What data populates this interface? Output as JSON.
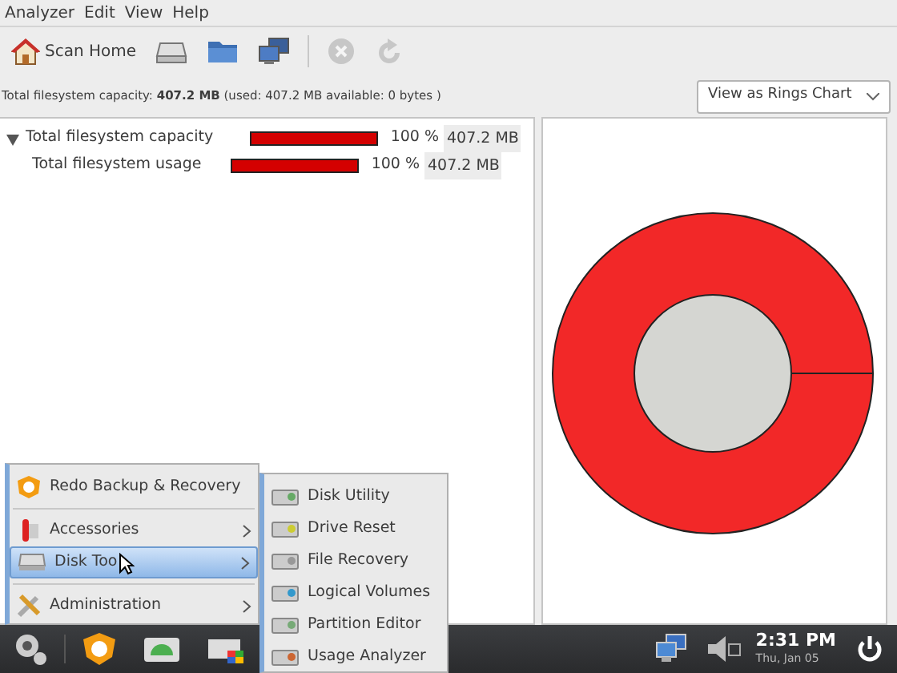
{
  "menu_bar": [
    "Analyzer",
    "Edit",
    "View",
    "Help"
  ],
  "toolbar": [
    {
      "kind": "button",
      "label": "Scan Home",
      "disabled": false
    },
    {
      "kind": "icon",
      "disabled": false
    },
    {
      "kind": "icon",
      "disabled": false
    },
    {
      "kind": "icon",
      "disabled": false
    },
    {
      "kind": "icon",
      "disabled": true
    },
    {
      "kind": "icon",
      "disabled": true
    }
  ],
  "summary": "Total filesystem capacity: **407.2 MB** (used: 407.2 MB available: 0 bytes )",
  "view_select": {
    "value": "View as Rings Chart"
  },
  "tree": [
    {
      "name": "Total filesystem capacity",
      "level": 1,
      "percent": "100 %",
      "size": "407.2 MB",
      "expanded": true,
      "children": [
        {
          "name": "Total filesystem usage",
          "level": 1,
          "percent": "100 %",
          "size": "407.2 MB"
        }
      ]
    }
  ],
  "app_menu": [
    {
      "label": "Redo Backup & Recovery",
      "kind": "item",
      "selected": false
    },
    {
      "label": "Accessories",
      "kind": "submenu",
      "selected": false
    },
    {
      "label": "Disk Too",
      "kind": "submenu",
      "selected": true
    },
    {
      "label": "Administration",
      "kind": "submenu",
      "selected": false
    }
  ],
  "submenu": [
    "Disk Utility",
    "Drive Reset",
    "File Recovery",
    "Logical Volumes",
    "Partition Editor",
    "Usage Analyzer"
  ],
  "taskbar": {
    "clock": "2:31 PM",
    "date": "Thu, Jan 05"
  }
}
